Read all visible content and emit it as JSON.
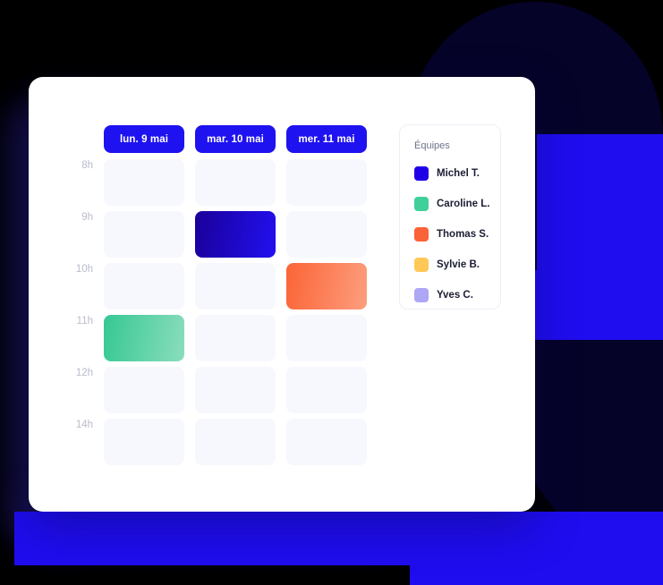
{
  "background": {
    "canvas_color": "#000000",
    "navy": "#050328",
    "blue": "#1F0DEF",
    "shapes": [
      {
        "name": "dome-top-right",
        "color": "#050328"
      },
      {
        "name": "blue-block-upper-right",
        "color": "#1F0DEF"
      },
      {
        "name": "blue-band-right",
        "color": "#1F0DEF"
      },
      {
        "name": "navy-block-lower-right",
        "color": "#050328"
      },
      {
        "name": "blue-block-bottom",
        "color": "#1F0DEF"
      }
    ]
  },
  "card": {
    "background": "#FFFFFF",
    "radius_px": 16
  },
  "scheduler": {
    "days": [
      {
        "label": "lun. 9 mai"
      },
      {
        "label": "mar. 10 mai"
      },
      {
        "label": "mer. 11 mai"
      }
    ],
    "day_pill_color": "#1F12F0",
    "times": [
      "8h",
      "9h",
      "10h",
      "11h",
      "12h",
      "14h"
    ],
    "empty_cell_color": "#F7F8FD",
    "rows": [
      {
        "time": "8h",
        "cells": [
          {
            "state": "empty",
            "event": null
          },
          {
            "state": "empty",
            "event": null
          },
          {
            "state": "empty",
            "event": null
          }
        ]
      },
      {
        "time": "9h",
        "cells": [
          {
            "state": "empty",
            "event": null
          },
          {
            "state": "event",
            "event": {
              "owner": "Michel T.",
              "color_from": "#1A0099",
              "color_to": "#2210F0",
              "style": "ev-blue"
            }
          },
          {
            "state": "empty",
            "event": null
          }
        ]
      },
      {
        "time": "10h",
        "cells": [
          {
            "state": "empty",
            "event": null
          },
          {
            "state": "empty",
            "event": null
          },
          {
            "state": "event",
            "event": {
              "owner": "Thomas S.",
              "color_from": "#FB6436",
              "color_to": "#FD9E7E",
              "style": "ev-orange"
            }
          }
        ]
      },
      {
        "time": "11h",
        "cells": [
          {
            "state": "event",
            "event": {
              "owner": "Caroline L.",
              "color_from": "#36C894",
              "color_to": "#8ADDBD",
              "style": "ev-green"
            }
          },
          {
            "state": "empty",
            "event": null
          },
          {
            "state": "empty",
            "event": null
          }
        ]
      },
      {
        "time": "12h",
        "cells": [
          {
            "state": "empty",
            "event": null
          },
          {
            "state": "empty",
            "event": null
          },
          {
            "state": "empty",
            "event": null
          }
        ]
      },
      {
        "time": "14h",
        "cells": [
          {
            "state": "empty",
            "event": null
          },
          {
            "state": "empty",
            "event": null
          },
          {
            "state": "empty",
            "event": null
          }
        ]
      }
    ]
  },
  "legend": {
    "title": "Équipes",
    "items": [
      {
        "label": "Michel T.",
        "color": "#2000E6"
      },
      {
        "label": "Caroline L.",
        "color": "#3ECF9A"
      },
      {
        "label": "Thomas S.",
        "color": "#FA6238"
      },
      {
        "label": "Sylvie B.",
        "color": "#FFC857"
      },
      {
        "label": "Yves C.",
        "color": "#ADA7F5"
      }
    ]
  }
}
